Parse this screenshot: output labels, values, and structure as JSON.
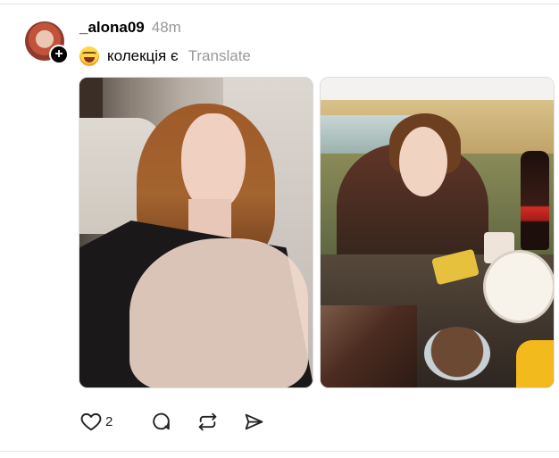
{
  "post": {
    "username": "_alona09",
    "timestamp": "48m",
    "caption_text": "колекція є",
    "translate_label": "Translate",
    "like_count": "2",
    "photos": [
      {
        "name": "photo-1"
      },
      {
        "name": "photo-2"
      }
    ]
  },
  "icons": {
    "follow": "plus-icon",
    "caption_emoji": "laughing-emoji-icon",
    "like": "heart-icon",
    "comment": "comment-icon",
    "repost": "repost-icon",
    "share": "share-icon"
  },
  "colors": {
    "text": "#000000",
    "muted": "#999999",
    "divider": "#e6e6e6"
  }
}
